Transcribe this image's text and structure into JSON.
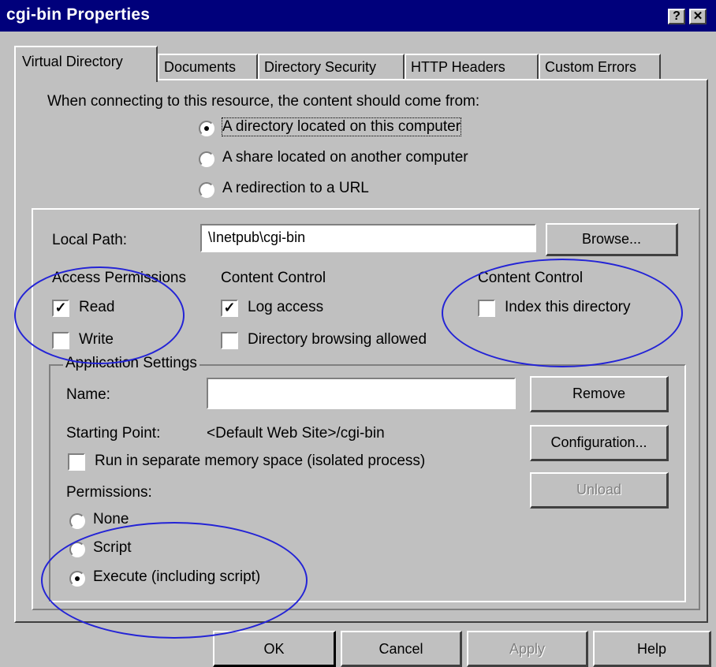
{
  "window": {
    "title": "cgi-bin Properties",
    "help_button": "?",
    "close_button": "✕"
  },
  "tabs": [
    {
      "label": "Virtual Directory",
      "active": true
    },
    {
      "label": "Documents",
      "active": false
    },
    {
      "label": "Directory Security",
      "active": false
    },
    {
      "label": "HTTP Headers",
      "active": false
    },
    {
      "label": "Custom Errors",
      "active": false
    }
  ],
  "source": {
    "prompt": "When connecting to this resource, the content should come from:",
    "options": [
      {
        "label": "A directory located on this computer",
        "selected": true
      },
      {
        "label": "A share located on another computer",
        "selected": false
      },
      {
        "label": "A redirection to a URL",
        "selected": false
      }
    ]
  },
  "local_path": {
    "label": "Local Path:",
    "value": "\\Inetpub\\cgi-bin",
    "browse_button": "Browse..."
  },
  "access_permissions": {
    "heading": "Access Permissions",
    "read": {
      "label": "Read",
      "checked": true
    },
    "write": {
      "label": "Write",
      "checked": false
    }
  },
  "content_control_1": {
    "heading": "Content Control",
    "log_access": {
      "label": "Log access",
      "checked": true
    },
    "dir_browsing": {
      "label": "Directory browsing allowed",
      "checked": false
    }
  },
  "content_control_2": {
    "heading": "Content Control",
    "index": {
      "label": "Index this directory",
      "checked": false
    }
  },
  "app_settings": {
    "heading": "Application Settings",
    "name_label": "Name:",
    "name_value": "",
    "starting_point_label": "Starting Point:",
    "starting_point_value": "<Default Web Site>/cgi-bin",
    "isolated": {
      "label": "Run in separate memory space (isolated process)",
      "checked": false
    },
    "permissions_label": "Permissions:",
    "permissions": [
      {
        "label": "None",
        "selected": false
      },
      {
        "label": "Script",
        "selected": false
      },
      {
        "label": "Execute (including script)",
        "selected": true
      }
    ],
    "remove_button": "Remove",
    "configuration_button": "Configuration...",
    "unload_button": "Unload"
  },
  "footer": {
    "ok": "OK",
    "cancel": "Cancel",
    "apply": "Apply",
    "help": "Help"
  },
  "colors": {
    "titlebar": "#00007b",
    "dialog_bg": "#c0c0c0",
    "annotation": "#2323d6"
  }
}
